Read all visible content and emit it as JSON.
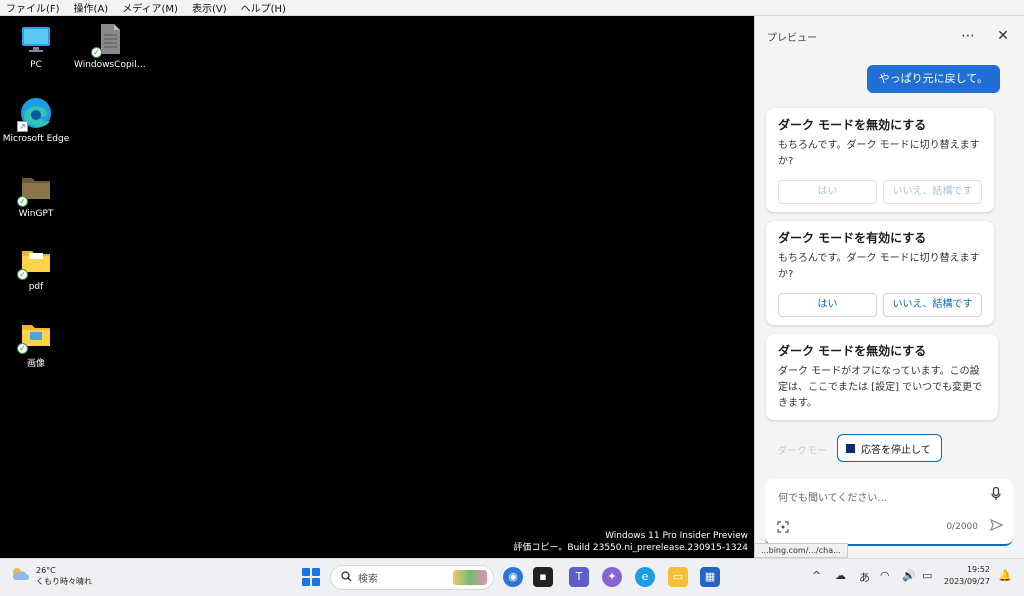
{
  "menubar": {
    "items": [
      "ファイル(F)",
      "操作(A)",
      "メディア(M)",
      "表示(V)",
      "ヘルプ(H)"
    ]
  },
  "desktop": {
    "icons": [
      {
        "label": "PC",
        "icon": "monitor-icon"
      },
      {
        "label": "WindowsCopilo...",
        "icon": "document-icon"
      },
      {
        "label": "Microsoft Edge",
        "icon": "edge-icon"
      },
      {
        "label": "WinGPT",
        "icon": "folder-icon"
      },
      {
        "label": "pdf",
        "icon": "folder-icon"
      },
      {
        "label": "画像",
        "icon": "folder-icon"
      }
    ],
    "watermark_line1": "Windows 11 Pro Insider Preview",
    "watermark_line2": "評価コピー。Build 23550.ni_prerelease.230915-1324"
  },
  "panel": {
    "title": "プレビュー",
    "more_label": "⋯",
    "close_label": "✕",
    "user_message": "やっぱり元に戻して。",
    "cards": [
      {
        "title": "ダーク モードを無効にする",
        "body": "もちろんです。ダーク モードに切り替えますか?",
        "yes": "はい",
        "no": "いいえ、結構です"
      },
      {
        "title": "ダーク モードを有効にする",
        "body": "もちろんです。ダーク モードに切り替えますか?",
        "yes": "はい",
        "no": "いいえ、結構です"
      },
      {
        "title": "ダーク モードを無効にする",
        "body": "ダーク モードがオフになっています。この設定は、ここでまたは [設定] でいつでも変更できます。"
      }
    ],
    "ghost_text": "ダークモー",
    "stop_label": "応答を停止して",
    "input_placeholder": "何でも聞いてください...",
    "counter": "0/2000"
  },
  "status_url": "...bing.com/.../cha...",
  "taskbar": {
    "temp": "26°C",
    "weather": "くもり時々晴れ",
    "search_label": "検索",
    "ime_label": "あ",
    "time": "19:52",
    "date": "2023/09/27"
  },
  "colors": {
    "accent": "#1f6fd6",
    "link": "#0f6cbd",
    "panel_bg": "#f3f4f6"
  }
}
